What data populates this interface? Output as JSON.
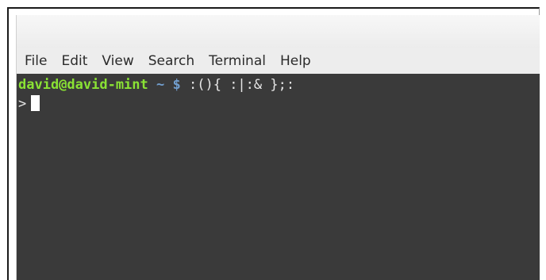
{
  "menubar": {
    "items": [
      "File",
      "Edit",
      "View",
      "Search",
      "Terminal",
      "Help"
    ]
  },
  "terminal": {
    "prompt_user_host": "david@david-mint",
    "prompt_path": "~",
    "prompt_sign": "$",
    "command": ":(){ :|:& };:",
    "continuation_prompt": ">"
  },
  "colors": {
    "terminal_background": "#3a3a3a",
    "prompt_user_color": "#8ae234",
    "prompt_path_color": "#729fcf"
  }
}
